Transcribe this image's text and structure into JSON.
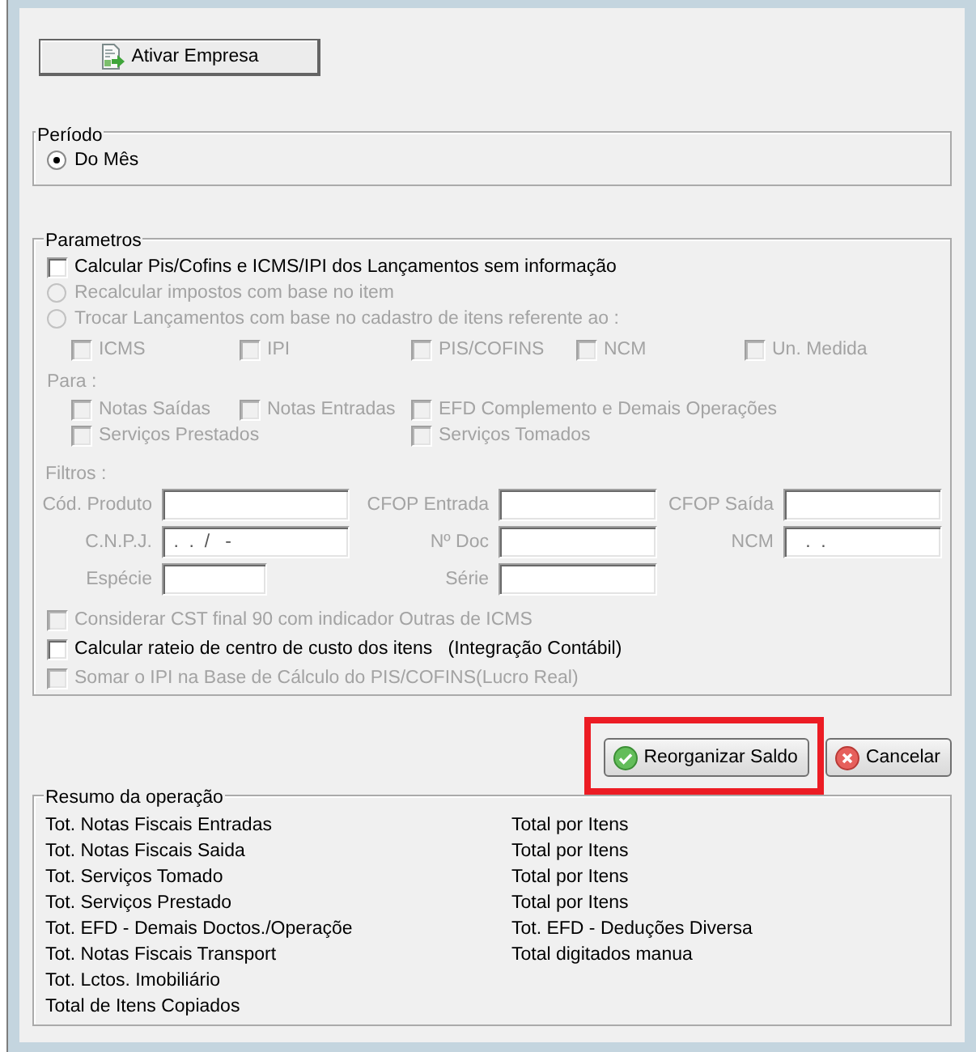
{
  "activate_button": {
    "label": "Ativar Empresa"
  },
  "periodo": {
    "legend": "Período",
    "options": [
      {
        "label": "Do Mês",
        "selected": true,
        "disabled": false
      }
    ]
  },
  "parametros": {
    "legend": "Parametros",
    "options": [
      {
        "kind": "checkbox",
        "label": "Calcular Pis/Cofins e ICMS/IPI dos Lançamentos sem informação",
        "checked": false,
        "disabled": false
      },
      {
        "kind": "radio",
        "label": "Recalcular impostos com base no item",
        "selected": false,
        "disabled": true
      },
      {
        "kind": "radio",
        "label": "Trocar Lançamentos com base no cadastro de itens referente ao :",
        "selected": false,
        "disabled": true
      }
    ],
    "campos": [
      {
        "label": "ICMS",
        "checked": false,
        "disabled": true
      },
      {
        "label": "IPI",
        "checked": false,
        "disabled": true
      },
      {
        "label": "PIS/COFINS",
        "checked": false,
        "disabled": true
      },
      {
        "label": "NCM",
        "checked": false,
        "disabled": true
      },
      {
        "label": "Un. Medida",
        "checked": false,
        "disabled": true
      }
    ],
    "para": {
      "label": "Para :",
      "disabled": true,
      "rows": [
        [
          {
            "label": "Notas Saídas",
            "checked": false,
            "disabled": true
          },
          {
            "label": "Notas Entradas",
            "checked": false,
            "disabled": true
          },
          {
            "label": "EFD Complemento e Demais Operações",
            "checked": false,
            "disabled": true
          }
        ],
        [
          {
            "label": "Serviços Prestados",
            "checked": false,
            "disabled": true
          },
          "",
          {
            "label": "Serviços Tomados",
            "checked": false,
            "disabled": true
          }
        ]
      ]
    },
    "filtros": {
      "label": "Filtros :",
      "disabled": true,
      "rows": [
        [
          {
            "label": "Cód. Produto",
            "kind": "text"
          },
          {
            "label": "CFOP Entrada",
            "kind": "text"
          },
          {
            "label": "CFOP Saída",
            "kind": "text"
          }
        ],
        [
          {
            "label": "C.N.P.J.",
            "kind": "text",
            "value": " .  .  /   -"
          },
          {
            "label": "Nº Doc",
            "kind": "text"
          },
          {
            "label": "NCM",
            "kind": "text",
            "value": "   .  ."
          }
        ],
        [
          {
            "label": "Espécie",
            "kind": "short"
          },
          {
            "label": "Série",
            "kind": "text"
          }
        ]
      ]
    },
    "extras": [
      {
        "label": "Considerar CST final 90 com indicador Outras de ICMS",
        "checked": false,
        "disabled": true
      },
      {
        "label": "Calcular rateio de centro de custo dos itens   (Integração Contábil)",
        "checked": false,
        "disabled": false
      },
      {
        "label": "Somar o IPI na Base de Cálculo do PIS/COFINS(Lucro Real)",
        "checked": false,
        "disabled": true
      }
    ]
  },
  "actions": [
    {
      "label": "Reorganizar Saldo",
      "kind": "confirm",
      "highlighted": true
    },
    {
      "label": "Cancelar",
      "kind": "cancel",
      "highlighted": false
    }
  ],
  "resumo": {
    "legend": "Resumo da operação",
    "left": [
      "Tot. Notas Fiscais Entradas",
      "Tot. Notas Fiscais Saida",
      "Tot. Serviços Tomado",
      "Tot. Serviços Prestado",
      "Tot. EFD - Demais Doctos./Operaçõe",
      "Tot. Notas Fiscais Transport",
      "Tot. Lctos. Imobiliário",
      "Total de Itens Copiados"
    ],
    "right": [
      "Total por Itens",
      "Total por Itens",
      "Total por Itens",
      "Total por Itens",
      "Tot. EFD - Deduções Diversa",
      "Total digitados manua"
    ]
  }
}
